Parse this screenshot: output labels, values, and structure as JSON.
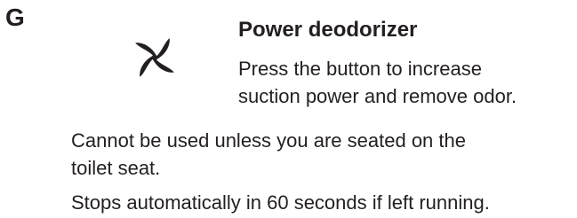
{
  "section": {
    "letter": "G"
  },
  "feature": {
    "icon": "fan-icon",
    "title": "Power deodorizer",
    "description_lines": [
      "Press the button to increase",
      "suction power and remove odor."
    ]
  },
  "notes": [
    {
      "lines": [
        "Cannot be used unless you are seated on the",
        "toilet seat."
      ]
    },
    {
      "lines": [
        "Stops automatically in 60 seconds if left running."
      ]
    }
  ]
}
